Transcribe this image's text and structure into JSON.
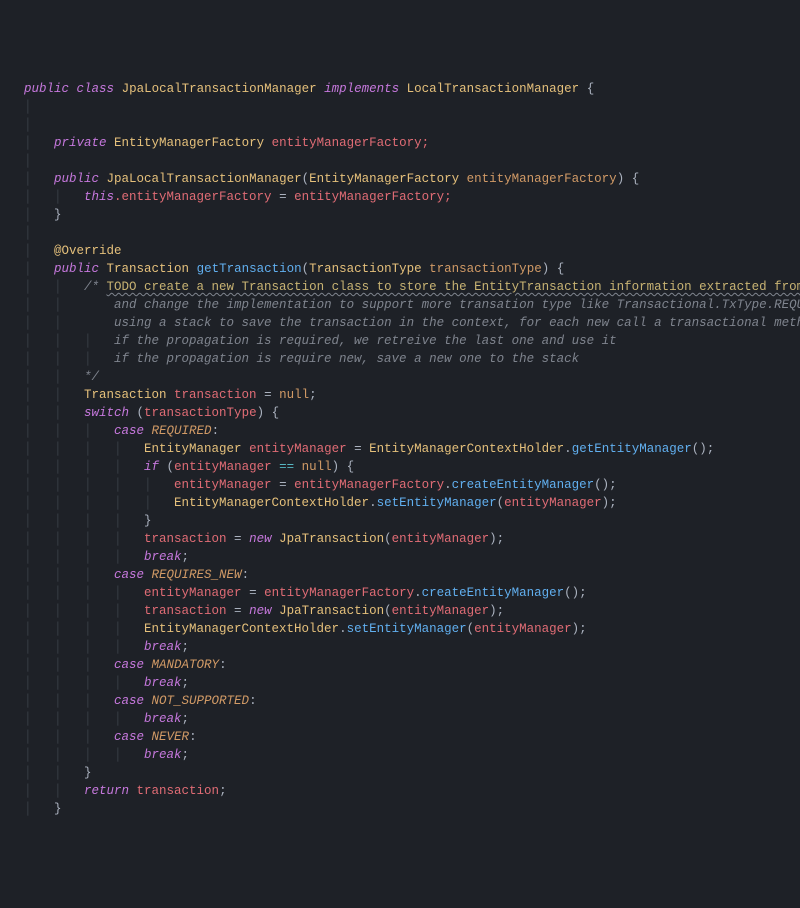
{
  "code": {
    "class_decl": {
      "mod": "public",
      "kw": "class",
      "name": "JpaLocalTransactionManager",
      "impl_kw": "implements",
      "impl_name": "LocalTransactionManager"
    },
    "field": {
      "mod": "private",
      "type": "EntityManagerFactory",
      "name": "entityManagerFactory;"
    },
    "ctor": {
      "mod": "public",
      "name": "JpaLocalTransactionManager",
      "ptype": "EntityManagerFactory",
      "pname": "entityManagerFactory",
      "body_this": "this",
      "body_lhs": ".entityManagerFactory",
      "body_eq": " = ",
      "body_rhs": "entityManagerFactory;"
    },
    "anno": "@Override",
    "mdecl": {
      "mod": "public",
      "ret": "Transaction",
      "name": "getTransaction",
      "ptype": "TransactionType",
      "pname": "transactionType"
    },
    "todo1": "TODO create a new Transaction class to store the EntityTransaction information extracted from m",
    "todo2": "and change the implementation to support more transation type like Transactional.TxType.REQUIR",
    "todo3": "using a stack to save the transaction in the context, for each new call a transactional method",
    "todo4": "if the propagation is required, we retreive the last one and use it",
    "todo5": "if the propagation is require new, save a new one to the stack",
    "tx_decl_type": "Transaction",
    "tx_decl_name": "transaction",
    "tx_decl_eq": " = ",
    "tx_decl_null": "null",
    "sw_kw": "switch",
    "sw_expr": "transactionType",
    "case_req": "REQUIRED",
    "case_reqnew": "REQUIRES_NEW",
    "case_mand": "MANDATORY",
    "case_nsup": "NOT_SUPPORTED",
    "case_never": "NEVER",
    "em_type": "EntityManager",
    "em_name": "entityManager",
    "holder": "EntityManagerContextHolder",
    "getEM": "getEntityManager",
    "setEM": "setEntityManager",
    "createEM": "createEntityManager",
    "emf": "entityManagerFactory",
    "jpa_tx": "JpaTransaction",
    "if_kw": "if",
    "new_kw": "new",
    "case_kw": "case",
    "break_kw": "break",
    "return_kw": "return"
  }
}
